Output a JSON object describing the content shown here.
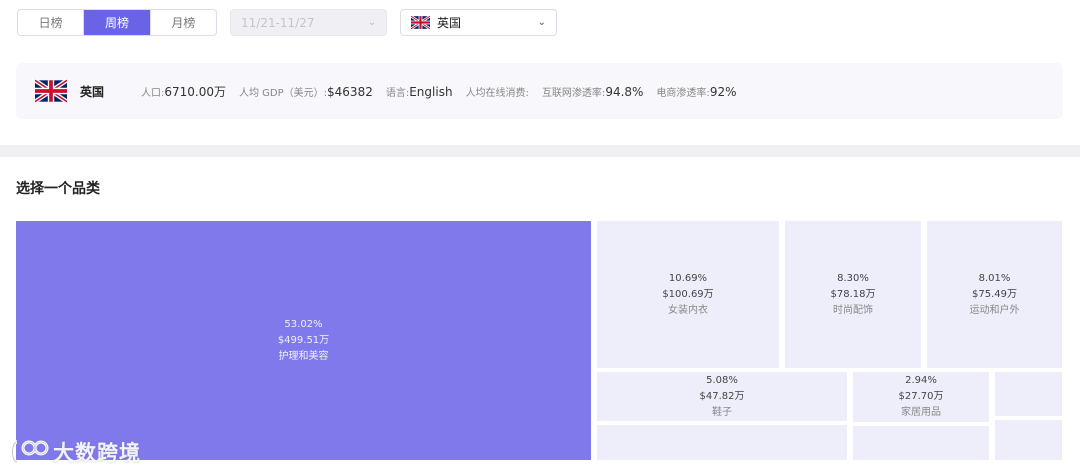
{
  "period_tabs": [
    {
      "label": "日榜",
      "active": false
    },
    {
      "label": "周榜",
      "active": true
    },
    {
      "label": "月榜",
      "active": false
    }
  ],
  "date_range": "11/21-11/27",
  "country_select": {
    "label": "英国",
    "flag": "uk-flag-icon"
  },
  "country_info": {
    "name": "英国",
    "flag": "uk-flag-icon",
    "stats": [
      {
        "label": "人口:",
        "value": "6710.00万"
      },
      {
        "label": "人均 GDP（美元）:",
        "value": "$46382"
      },
      {
        "label": "语言:",
        "value": "English"
      },
      {
        "label": "人均在线消费:",
        "value": ""
      },
      {
        "label": "互联网渗透率:",
        "value": "94.8%"
      },
      {
        "label": "电商渗透率:",
        "value": "92%"
      }
    ]
  },
  "section_title": "选择一个品类",
  "categories": [
    {
      "name": "护理和美容",
      "share": "53.02%",
      "amount": "$499.51万"
    },
    {
      "name": "女装内衣",
      "share": "10.69%",
      "amount": "$100.69万"
    },
    {
      "name": "时尚配饰",
      "share": "8.30%",
      "amount": "$78.18万"
    },
    {
      "name": "运动和户外",
      "share": "8.01%",
      "amount": "$75.49万"
    },
    {
      "name": "鞋子",
      "share": "5.08%",
      "amount": "$47.82万"
    },
    {
      "name": "家居用品",
      "share": "2.94%",
      "amount": "$27.70万"
    }
  ],
  "watermark": {
    "text": "大数跨境",
    "icon": "logo-icon"
  },
  "colors": {
    "accent": "#6b63e6",
    "treemap_primary": "#8079ec",
    "treemap_secondary": "#eeeefb"
  }
}
